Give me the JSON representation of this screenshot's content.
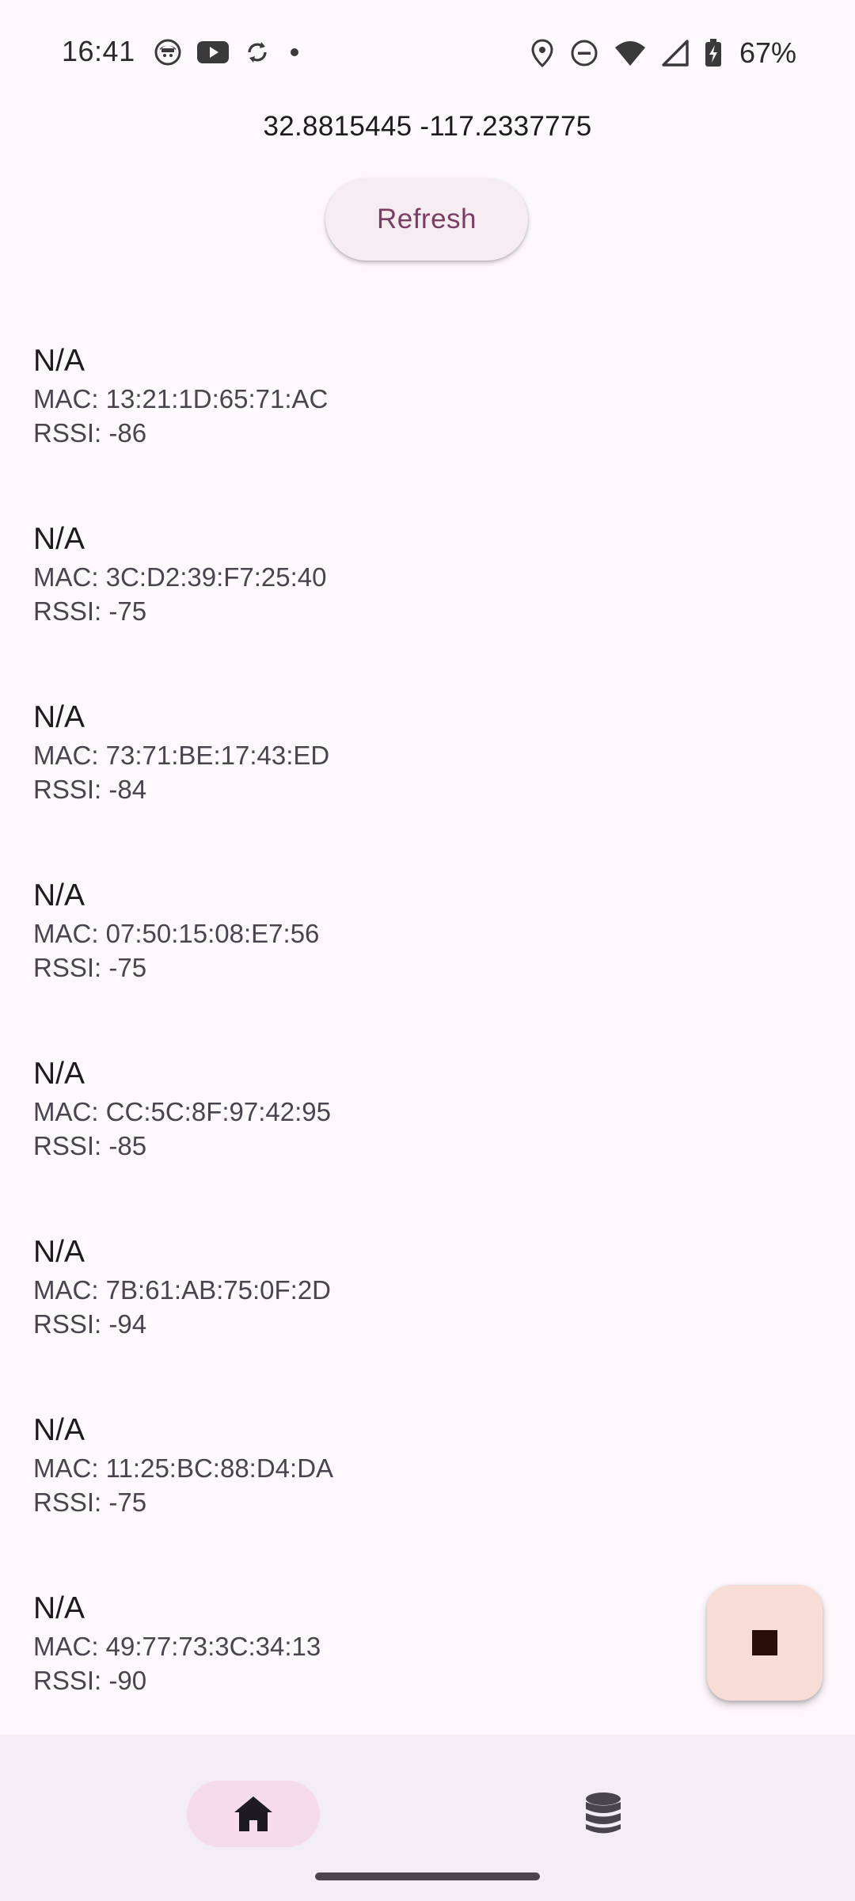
{
  "status_bar": {
    "time": "16:41",
    "battery_percent": "67%",
    "left_icons": [
      "app-notification-icon",
      "youtube-icon",
      "sync-icon",
      "more-dot-icon"
    ],
    "right_icons": [
      "location-icon",
      "do-not-disturb-icon",
      "wifi-icon",
      "cell-signal-icon",
      "battery-charging-icon"
    ]
  },
  "location": {
    "coordinates": "32.8815445 -117.2337775"
  },
  "actions": {
    "refresh_label": "Refresh"
  },
  "devices": [
    {
      "name": "N/A",
      "mac": "MAC: 13:21:1D:65:71:AC",
      "rssi": "RSSI: -86"
    },
    {
      "name": "N/A",
      "mac": "MAC: 3C:D2:39:F7:25:40",
      "rssi": "RSSI: -75"
    },
    {
      "name": "N/A",
      "mac": "MAC: 73:71:BE:17:43:ED",
      "rssi": "RSSI: -84"
    },
    {
      "name": "N/A",
      "mac": "MAC: 07:50:15:08:E7:56",
      "rssi": "RSSI: -75"
    },
    {
      "name": "N/A",
      "mac": "MAC: CC:5C:8F:97:42:95",
      "rssi": "RSSI: -85"
    },
    {
      "name": "N/A",
      "mac": "MAC: 7B:61:AB:75:0F:2D",
      "rssi": "RSSI: -94"
    },
    {
      "name": "N/A",
      "mac": "MAC: 11:25:BC:88:D4:DA",
      "rssi": "RSSI: -75"
    },
    {
      "name": "N/A",
      "mac": "MAC: 49:77:73:3C:34:13",
      "rssi": "RSSI: -90"
    }
  ],
  "fab": {
    "icon": "stop-icon"
  },
  "bottom_nav": {
    "items": [
      {
        "icon": "home-icon",
        "selected": true
      },
      {
        "icon": "database-icon",
        "selected": false
      }
    ]
  },
  "colors": {
    "background": "#fdf8fc",
    "accent_text": "#7b3e62",
    "fab_bg": "#f8dcd6",
    "nav_bg": "#f3edf5",
    "nav_selected": "#f6dbe8"
  }
}
